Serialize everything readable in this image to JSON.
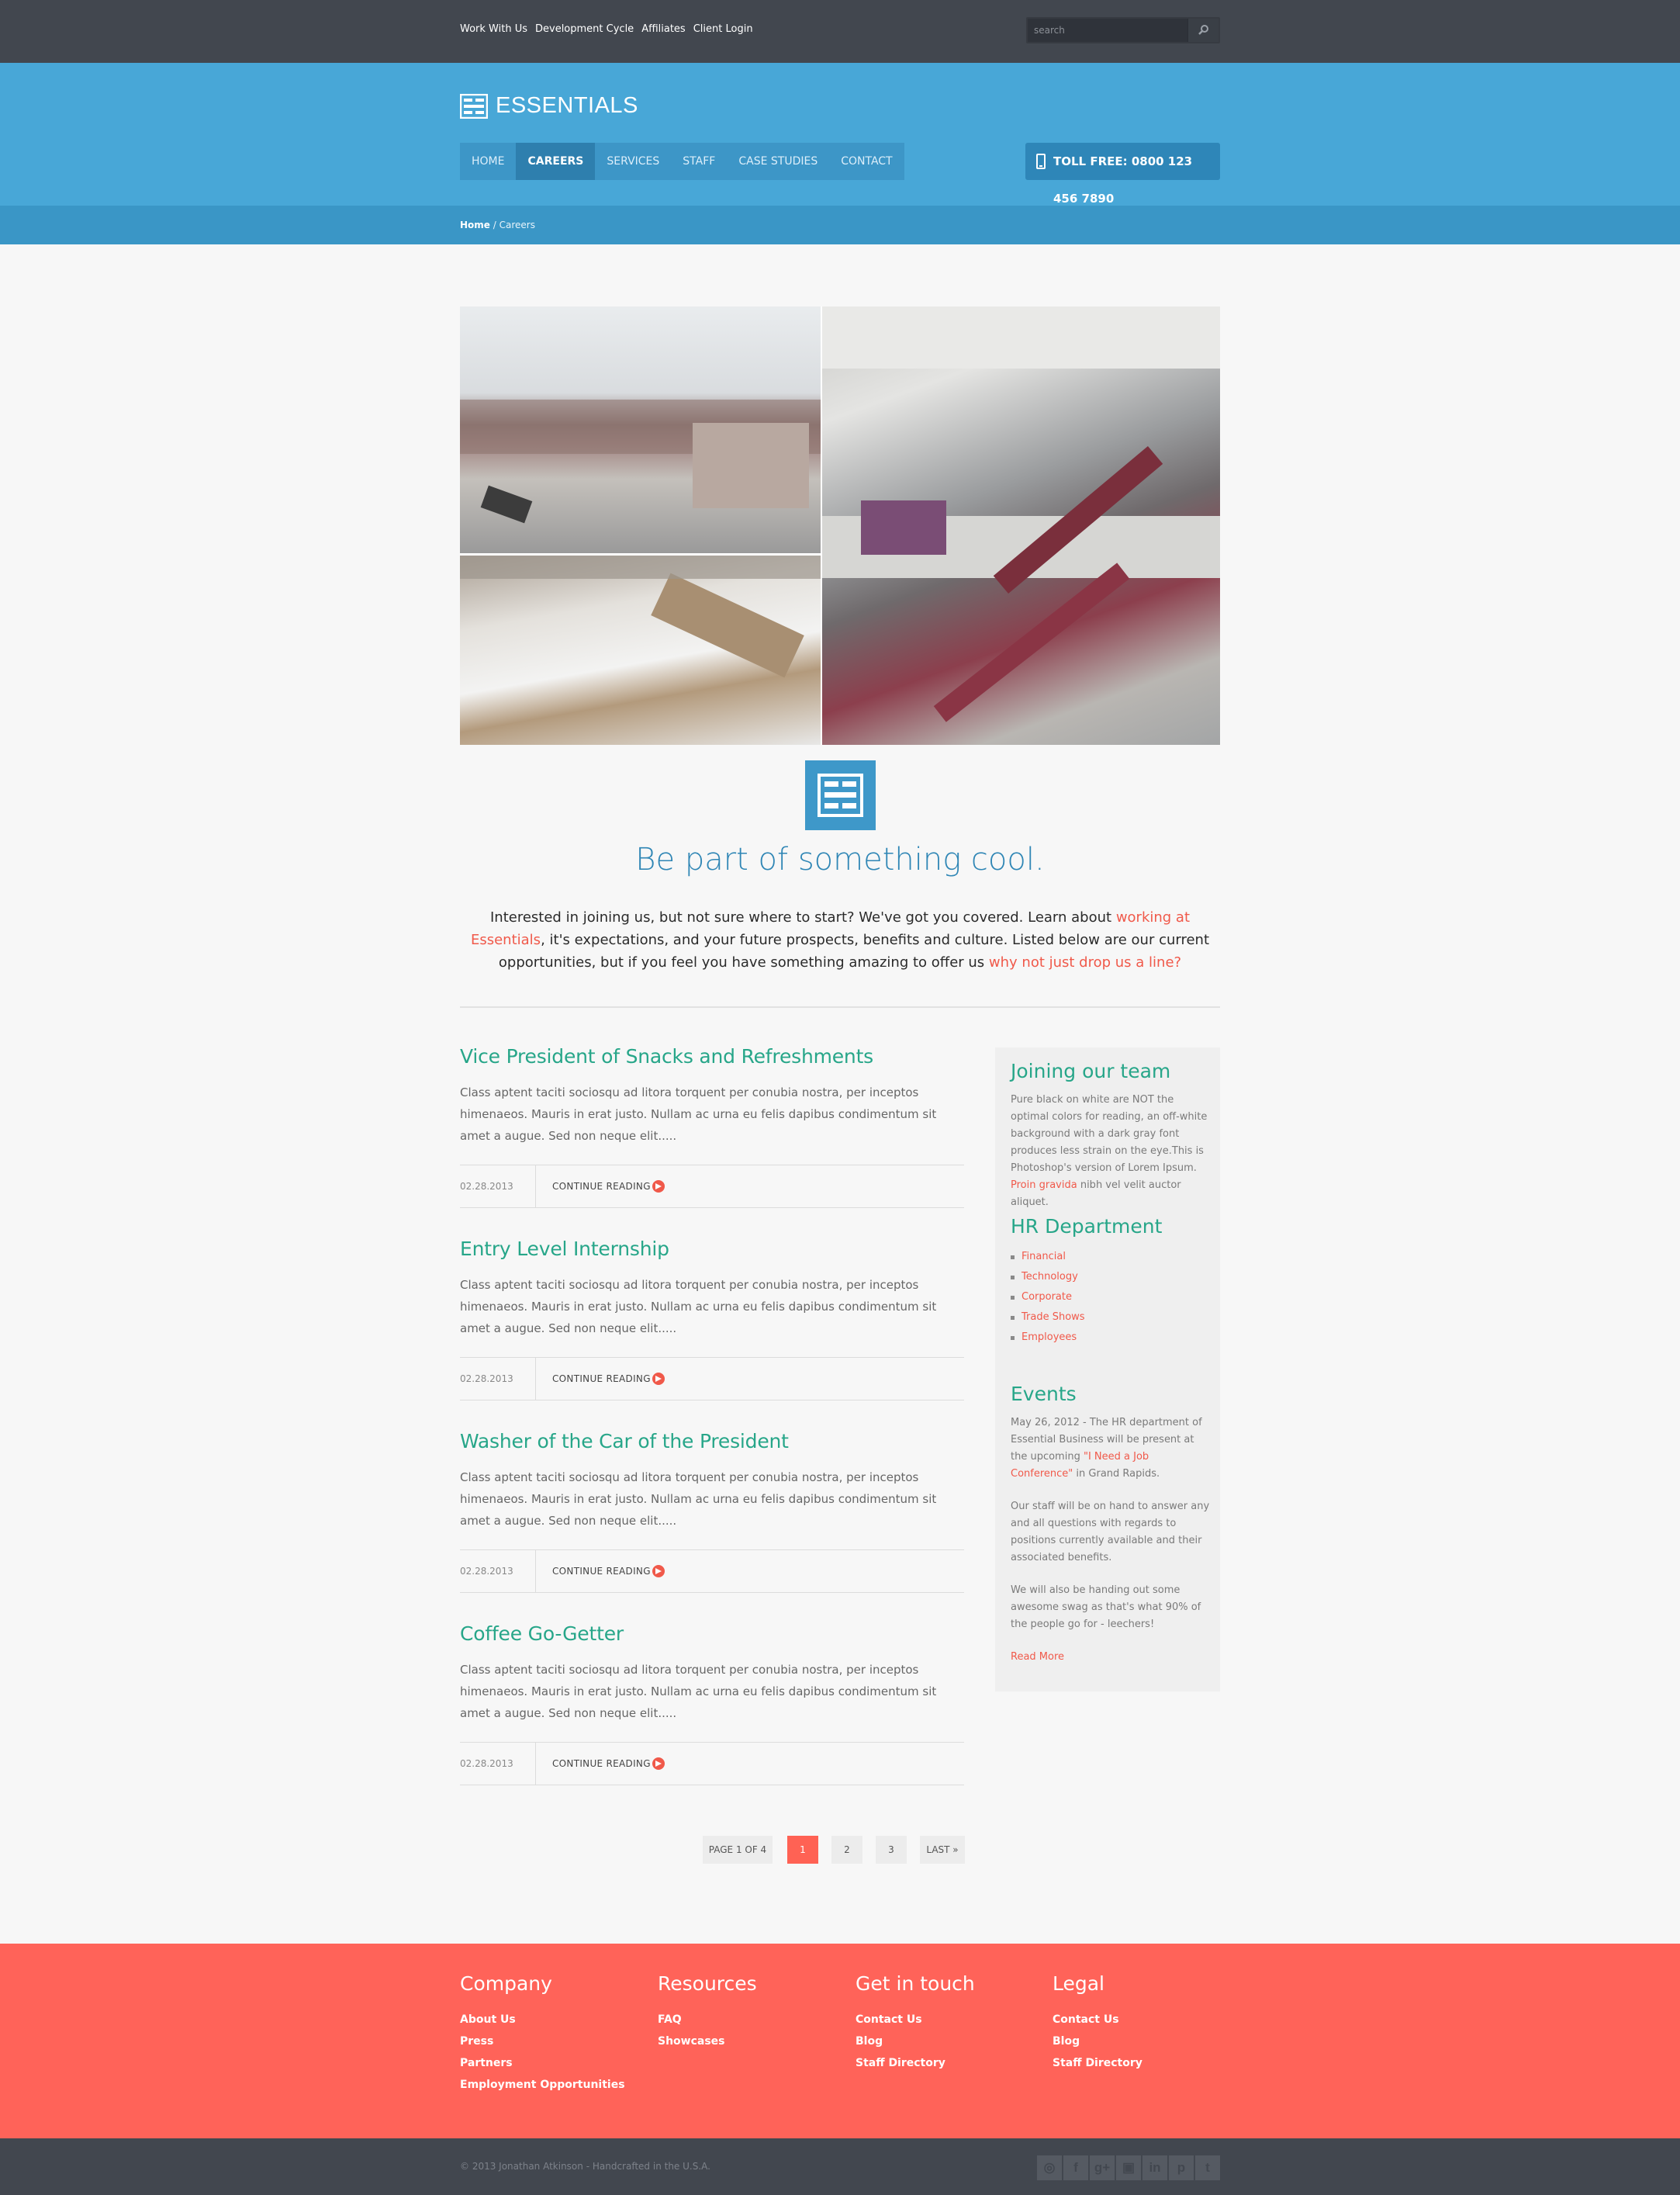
{
  "topbar": {
    "links": [
      "Work With Us",
      "Development Cycle",
      "Affiliates",
      "Client Login"
    ],
    "search_placeholder": "search"
  },
  "brand": {
    "name": "ESSENTIALS"
  },
  "nav": {
    "items": [
      "HOME",
      "CAREERS",
      "SERVICES",
      "STAFF",
      "CASE STUDIES",
      "CONTACT"
    ],
    "active": "CAREERS",
    "phone": "TOLL FREE: 0800 123 456 7890"
  },
  "breadcrumb": {
    "home": "Home",
    "separator": "/",
    "current": "Careers"
  },
  "hero": {
    "headline": "Be part of something cool.",
    "intro_1": "Interested in joining us, but not sure where to start? We've got you covered. Learn about ",
    "intro_link_1": "working at Essentials",
    "intro_2": ", it's expectations, and your future prospects, benefits and culture. Listed below are our current opportunities, but if you feel you have something amazing to offer us ",
    "intro_link_2": "why not just drop us a line?"
  },
  "posts": [
    {
      "title": "Vice President of Snacks and Refreshments",
      "excerpt": "Class aptent taciti sociosqu ad litora torquent per conubia nostra, per inceptos himenaeos. Mauris in erat justo. Nullam ac urna eu felis dapibus condimentum sit amet a augue. Sed non neque elit.....",
      "date": "02.28.2013",
      "more": "CONTINUE READING"
    },
    {
      "title": "Entry Level Internship",
      "excerpt": "Class aptent taciti sociosqu ad litora torquent per conubia nostra, per inceptos himenaeos. Mauris in erat justo. Nullam ac urna eu felis dapibus condimentum sit amet a augue. Sed non neque elit.....",
      "date": "02.28.2013",
      "more": "CONTINUE READING"
    },
    {
      "title": "Washer of the Car of the President",
      "excerpt": "Class aptent taciti sociosqu ad litora torquent per conubia nostra, per inceptos himenaeos. Mauris in erat justo. Nullam ac urna eu felis dapibus condimentum sit amet a augue. Sed non neque elit.....",
      "date": "02.28.2013",
      "more": "CONTINUE READING"
    },
    {
      "title": "Coffee Go-Getter",
      "excerpt": "Class aptent taciti sociosqu ad litora torquent per conubia nostra, per inceptos himenaeos. Mauris in erat justo. Nullam ac urna eu felis dapibus condimentum sit amet a augue. Sed non neque elit.....",
      "date": "02.28.2013",
      "more": "CONTINUE READING"
    }
  ],
  "sidebar": {
    "joining": {
      "title": "Joining our team",
      "text": "Pure black on white are NOT the optimal colors for reading, an off-white background with a dark gray font produces less strain on the eye.This is Photoshop's version of Lorem Ipsum. ",
      "link": "Proin gravida",
      "text_after": " nibh vel velit auctor aliquet."
    },
    "hr": {
      "title": "HR Department",
      "items": [
        "Financial",
        "Technology",
        "Corporate",
        "Trade Shows",
        "Employees"
      ]
    },
    "events": {
      "title": "Events",
      "p1_before": "May 26, 2012 - The HR department of Essential Business will be present at the upcoming ",
      "p1_link": "\"I Need a Job Conference\"",
      "p1_after": " in Grand Rapids.",
      "p2": "Our staff will be on hand to answer any and all questions with regards to positions currently available and their associated benefits.",
      "p3": "We will also be handing out some awesome swag as that's what 90% of the people go for - leechers!",
      "read_more": "Read More"
    }
  },
  "pagination": {
    "status": "PAGE 1 OF 4",
    "pages": [
      "1",
      "2",
      "3"
    ],
    "current": "1",
    "last": "LAST »"
  },
  "footer": {
    "columns": [
      {
        "title": "Company",
        "links": [
          "About Us",
          "Press",
          "Partners",
          "Employment Opportunities"
        ]
      },
      {
        "title": "Resources",
        "links": [
          "FAQ",
          "Showcases"
        ]
      },
      {
        "title": "Get in touch",
        "links": [
          "Contact Us",
          "Blog",
          "Staff Directory"
        ]
      },
      {
        "title": "Legal",
        "links": [
          "Contact Us",
          "Blog",
          "Staff Directory"
        ]
      }
    ],
    "copyright": "© 2013 Jonathan Atkinson - Handcrafted in the U.S.A.",
    "social_icons": [
      "dribbble-icon",
      "facebook-icon",
      "google-plus-icon",
      "instagram-icon",
      "linkedin-icon",
      "pinterest-icon",
      "twitter-icon"
    ]
  },
  "colors": {
    "header_blue": "#48a7d7",
    "accent_green": "#27a689",
    "accent_red": "#f0594a",
    "footer_coral": "#ff6359",
    "dark_bar": "#42474f"
  }
}
